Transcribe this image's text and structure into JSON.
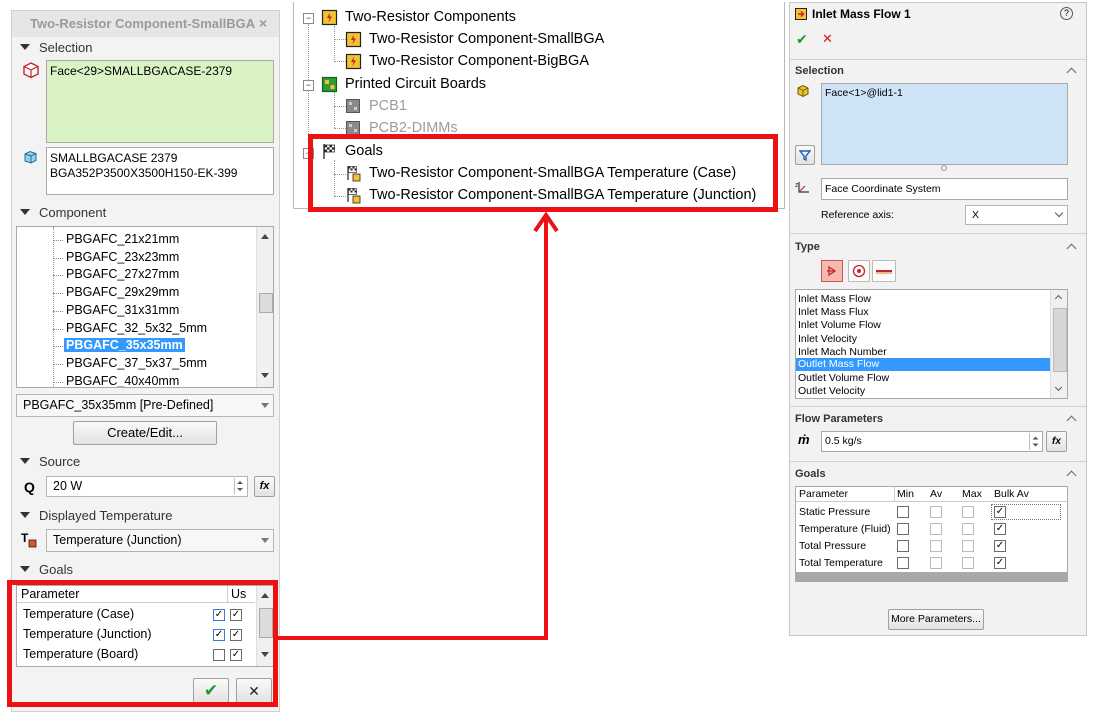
{
  "left_panel": {
    "title": "Two-Resistor Component-SmallBGA",
    "close": "×",
    "selection": {
      "header": "Selection",
      "face_value": "Face<29>SMALLBGACASE-2379",
      "component_line1": "SMALLBGACASE 2379",
      "component_line2": "BGA352P3500X3500H150-EK-399"
    },
    "component": {
      "header": "Component",
      "items": [
        "PBGAFC_21x21mm",
        "PBGAFC_23x23mm",
        "PBGAFC_27x27mm",
        "PBGAFC_29x29mm",
        "PBGAFC_31x31mm",
        "PBGAFC_32_5x32_5mm",
        "PBGAFC_35x35mm",
        "PBGAFC_37_5x37_5mm",
        "PBGAFC_40x40mm"
      ],
      "selected_value": "PBGAFC_35x35mm [Pre-Defined]",
      "create_edit": "Create/Edit..."
    },
    "source": {
      "header": "Source",
      "symbol": "Q",
      "value": "20 W",
      "fx": "fx"
    },
    "displayed_temperature": {
      "header": "Displayed Temperature",
      "value": "Temperature (Junction)"
    },
    "goals": {
      "header": "Goals",
      "col_parameter": "Parameter",
      "col_use": "Us",
      "rows": [
        {
          "name": "Temperature (Case)",
          "c1": "✓",
          "c2": "✓"
        },
        {
          "name": "Temperature (Junction)",
          "c1": "✓",
          "c2": "✓"
        },
        {
          "name": "Temperature (Board)",
          "c1": "",
          "c2": "✓"
        }
      ]
    },
    "ok": "✔",
    "cancel": "✕"
  },
  "tree": {
    "groups": [
      {
        "label": "Two-Resistor Components",
        "children": [
          "Two-Resistor Component-SmallBGA",
          "Two-Resistor Component-BigBGA"
        ]
      },
      {
        "label": "Printed Circuit Boards",
        "children": [
          "PCB1",
          "PCB2-DIMMs"
        ]
      },
      {
        "label": "Goals",
        "children": [
          "Two-Resistor Component-SmallBGA Temperature (Case)",
          "Two-Resistor Component-SmallBGA Temperature (Junction)"
        ]
      }
    ],
    "expander_symbol": "−"
  },
  "right_panel": {
    "title": "Inlet Mass Flow 1",
    "help": "?",
    "ok": "✔",
    "cancel": "✕",
    "selection": {
      "header": "Selection",
      "value": "Face<1>@lid1-1",
      "coord_system": "Face Coordinate System",
      "ref_axis_label": "Reference axis:",
      "ref_axis_value": "X"
    },
    "type": {
      "header": "Type",
      "items": [
        "Inlet Mass Flow",
        "Inlet Mass Flux",
        "Inlet Volume Flow",
        "Inlet Velocity",
        "Inlet Mach Number",
        "Outlet Mass Flow",
        "Outlet Volume Flow",
        "Outlet Velocity"
      ],
      "selected_index": 5
    },
    "flow_parameters": {
      "header": "Flow Parameters",
      "symbol": "ṁ",
      "value": "0.5 kg/s",
      "fx": "fx"
    },
    "goals": {
      "header": "Goals",
      "columns": [
        "Parameter",
        "Min",
        "Av",
        "Max",
        "Bulk Av"
      ],
      "rows": [
        {
          "name": "Static Pressure",
          "bulk": "✓"
        },
        {
          "name": "Temperature (Fluid)",
          "bulk": "✓"
        },
        {
          "name": "Total Pressure",
          "bulk": "✓"
        },
        {
          "name": "Total Temperature",
          "bulk": "✓"
        }
      ]
    },
    "more_parameters": "More Parameters..."
  },
  "colors": {
    "highlight_red": "#ee1111",
    "selection_green": "#d9f3c4",
    "selection_blue": "#cfe3f7",
    "list_selected": "#3399ff"
  }
}
